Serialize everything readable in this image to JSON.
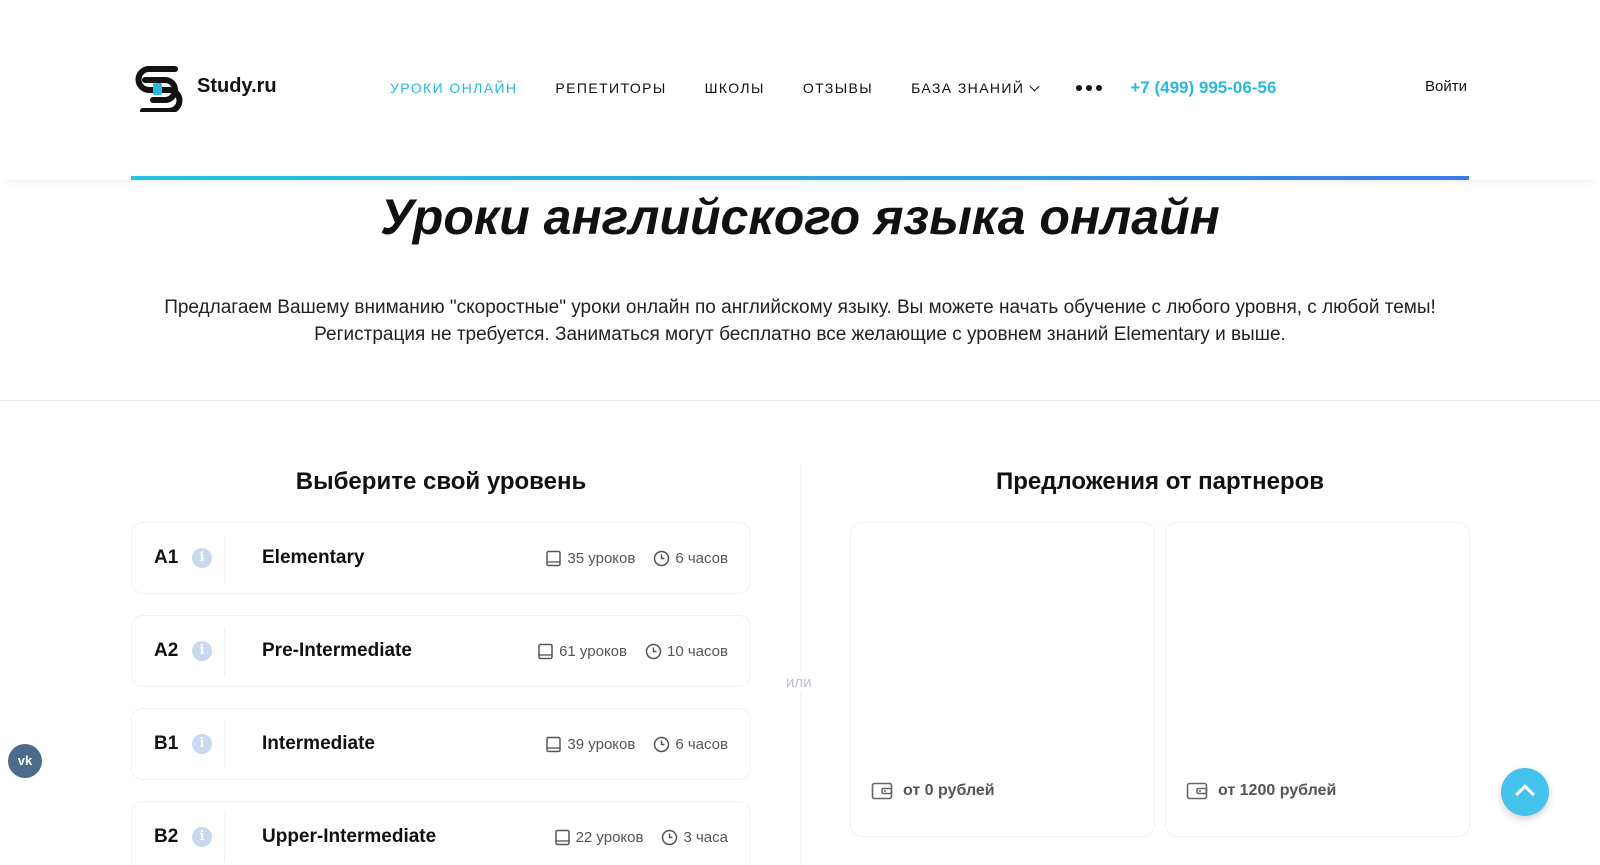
{
  "brand": {
    "name": "Study.ru"
  },
  "nav": {
    "items": [
      {
        "label": "Уроки онлайн",
        "active": true
      },
      {
        "label": "Репетиторы",
        "active": false
      },
      {
        "label": "Школы",
        "active": false
      },
      {
        "label": "Отзывы",
        "active": false
      },
      {
        "label": "База знаний",
        "active": false,
        "dropdown": true
      }
    ],
    "phone": "+7 (499) 995-06-56",
    "login": "Войти"
  },
  "hero": {
    "title": "Уроки английского языка онлайн",
    "text": "Предлагаем Вашему вниманию \"скоростные\" уроки онлайн по английскому языку. Вы можете начать обучение с любого уровня, с любой темы! Регистрация не требуется. Заниматься могут бесплатно все желающие с уровнем знаний Elementary и выше."
  },
  "levels": {
    "title": "Выберите свой уровень",
    "items": [
      {
        "code": "A1",
        "name": "Elementary",
        "lessons": "35 уроков",
        "hours": "6 часов"
      },
      {
        "code": "A2",
        "name": "Pre-Intermediate",
        "lessons": "61 уроков",
        "hours": "10 часов"
      },
      {
        "code": "B1",
        "name": "Intermediate",
        "lessons": "39 уроков",
        "hours": "6 часов"
      },
      {
        "code": "B2",
        "name": "Upper-Intermediate",
        "lessons": "22 уроков",
        "hours": "3 часа"
      }
    ]
  },
  "separator": {
    "or": "или"
  },
  "partners": {
    "title": "Предложения от партнеров",
    "cards": [
      {
        "price": "от 0 рублей"
      },
      {
        "price": "от 1200 рублей"
      }
    ]
  },
  "social": {
    "vk": "vk"
  },
  "colors": {
    "accent": "#28b8e0",
    "info": "#c8d8ee",
    "line_start": "#20c5e0",
    "line_end": "#3b78ea"
  }
}
